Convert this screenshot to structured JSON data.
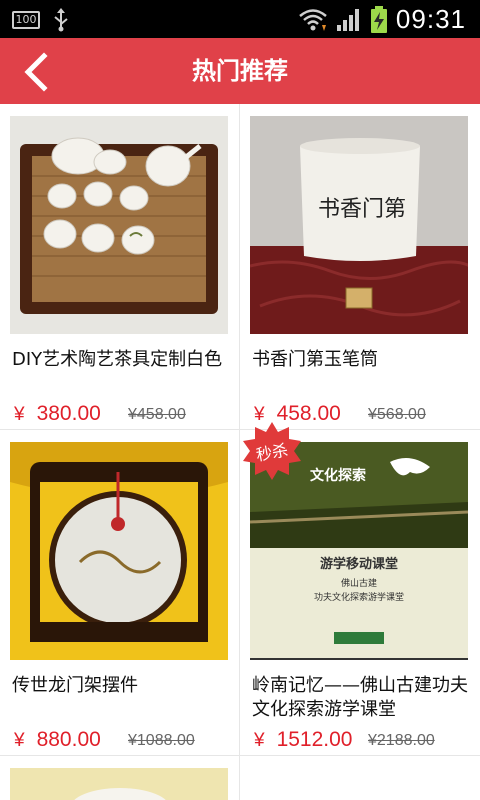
{
  "status_bar": {
    "battery_level": "100",
    "time": "09:31",
    "icons": [
      "usb-icon",
      "wifi-icon",
      "signal-icon",
      "battery-charging-icon"
    ]
  },
  "header": {
    "title": "热门推荐",
    "back_icon": "chevron-left-icon",
    "background": "#e04149"
  },
  "products": [
    {
      "name": "DIY艺术陶艺茶具定制白色",
      "currency": "¥",
      "price": "380.00",
      "old_price": "¥458.00"
    },
    {
      "name": "书香门第玉笔筒",
      "currency": "¥",
      "price": "458.00",
      "old_price": "¥568.00"
    },
    {
      "name": "传世龙门架摆件",
      "currency": "¥",
      "price": "880.00",
      "old_price": "¥1088.00"
    },
    {
      "name": "岭南记忆——佛山古建功夫文化探索游学课堂",
      "currency": "¥",
      "price": "1512.00",
      "old_price": "¥2188.00",
      "badge": "秒杀"
    }
  ],
  "product_images": {
    "penholder_calligraphy": "书香门第",
    "course_banner_top": "文化探索",
    "course_banner_mid": "游学移动课堂",
    "course_banner_sub1": "佛山古建",
    "course_banner_sub2": "功夫文化探索游学课堂"
  },
  "colors": {
    "price": "#e0202a",
    "divider": "#e6e6e6",
    "badge": "#e03a3a"
  }
}
